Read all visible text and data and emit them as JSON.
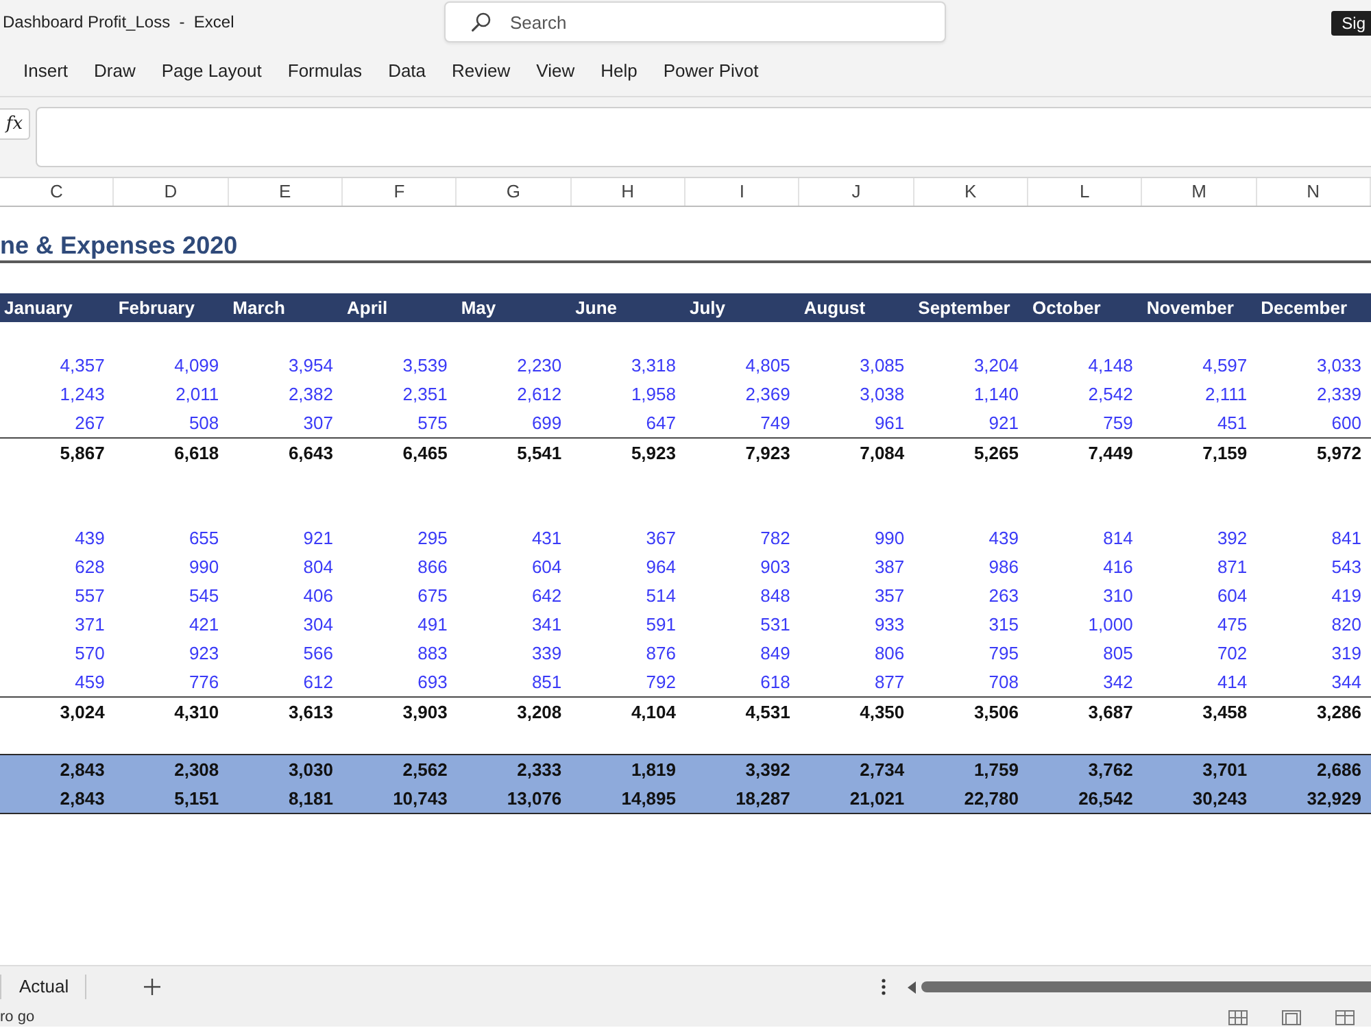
{
  "window": {
    "title": "Dashboard Profit_Loss  -  Excel",
    "account_button": "Sig"
  },
  "search": {
    "placeholder": "Search"
  },
  "ribbon": {
    "tabs": [
      {
        "label": "Insert",
        "selected": false
      },
      {
        "label": "Draw",
        "selected": false
      },
      {
        "label": "Page Layout",
        "selected": false
      },
      {
        "label": "Formulas",
        "selected": false
      },
      {
        "label": "Data",
        "selected": false
      },
      {
        "label": "Review",
        "selected": false
      },
      {
        "label": "View",
        "selected": false
      },
      {
        "label": "Help",
        "selected": false
      },
      {
        "label": "Power Pivot",
        "selected": false
      }
    ]
  },
  "formula_bar": {
    "function_button": "fx"
  },
  "column_headers": [
    "C",
    "D",
    "E",
    "F",
    "G",
    "H",
    "I",
    "J",
    "K",
    "L",
    "M",
    "N"
  ],
  "sheet": {
    "title": "ne & Expenses 2020",
    "months": [
      "January",
      "February",
      "March",
      "April",
      "May",
      "June",
      "July",
      "August",
      "September",
      "October",
      "November",
      "December"
    ],
    "rows": [
      {
        "kind": "blank"
      },
      {
        "kind": "input",
        "values": [
          "4,357",
          "4,099",
          "3,954",
          "3,539",
          "2,230",
          "3,318",
          "4,805",
          "3,085",
          "3,204",
          "4,148",
          "4,597",
          "3,033"
        ]
      },
      {
        "kind": "input",
        "values": [
          "1,243",
          "2,011",
          "2,382",
          "2,351",
          "2,612",
          "1,958",
          "2,369",
          "3,038",
          "1,140",
          "2,542",
          "2,111",
          "2,339"
        ]
      },
      {
        "kind": "input",
        "values": [
          "267",
          "508",
          "307",
          "575",
          "699",
          "647",
          "749",
          "961",
          "921",
          "759",
          "451",
          "600"
        ]
      },
      {
        "kind": "total",
        "values": [
          "5,867",
          "6,618",
          "6,643",
          "6,465",
          "5,541",
          "5,923",
          "7,923",
          "7,084",
          "5,265",
          "7,449",
          "7,159",
          "5,972"
        ]
      },
      {
        "kind": "blank"
      },
      {
        "kind": "blank"
      },
      {
        "kind": "input",
        "values": [
          "439",
          "655",
          "921",
          "295",
          "431",
          "367",
          "782",
          "990",
          "439",
          "814",
          "392",
          "841"
        ]
      },
      {
        "kind": "input",
        "values": [
          "628",
          "990",
          "804",
          "866",
          "604",
          "964",
          "903",
          "387",
          "986",
          "416",
          "871",
          "543"
        ]
      },
      {
        "kind": "input",
        "values": [
          "557",
          "545",
          "406",
          "675",
          "642",
          "514",
          "848",
          "357",
          "263",
          "310",
          "604",
          "419"
        ]
      },
      {
        "kind": "input",
        "values": [
          "371",
          "421",
          "304",
          "491",
          "341",
          "591",
          "531",
          "933",
          "315",
          "1,000",
          "475",
          "820"
        ]
      },
      {
        "kind": "input",
        "values": [
          "570",
          "923",
          "566",
          "883",
          "339",
          "876",
          "849",
          "806",
          "795",
          "805",
          "702",
          "319"
        ]
      },
      {
        "kind": "input",
        "values": [
          "459",
          "776",
          "612",
          "693",
          "851",
          "792",
          "618",
          "877",
          "708",
          "342",
          "414",
          "344"
        ]
      },
      {
        "kind": "total",
        "values": [
          "3,024",
          "4,310",
          "3,613",
          "3,903",
          "3,208",
          "4,104",
          "4,531",
          "4,350",
          "3,506",
          "3,687",
          "3,458",
          "3,286"
        ]
      },
      {
        "kind": "blank"
      },
      {
        "kind": "summary",
        "values": [
          "2,843",
          "2,308",
          "3,030",
          "2,562",
          "2,333",
          "1,819",
          "3,392",
          "2,734",
          "1,759",
          "3,762",
          "3,701",
          "2,686"
        ]
      },
      {
        "kind": "summary",
        "values": [
          "2,843",
          "5,151",
          "8,181",
          "10,743",
          "13,076",
          "14,895",
          "18,287",
          "21,021",
          "22,780",
          "26,542",
          "30,243",
          "32,929"
        ]
      }
    ]
  },
  "sheet_tabs": [
    {
      "label": "Actual",
      "selected": false
    }
  ],
  "status_bar": {
    "text": "ro go"
  }
}
